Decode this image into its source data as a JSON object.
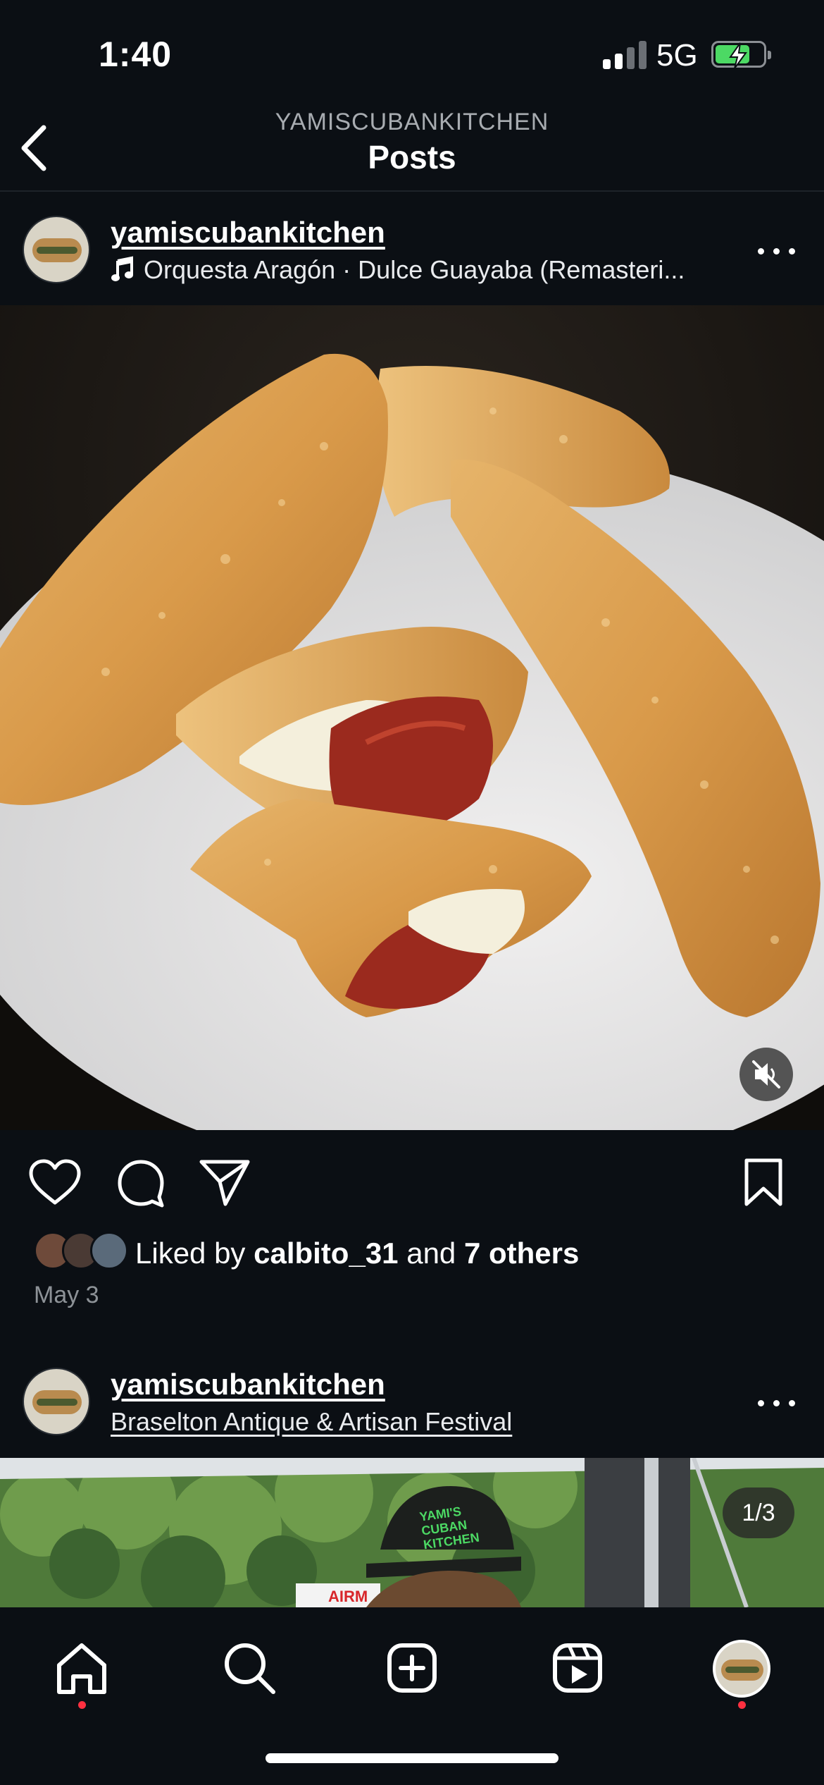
{
  "status_bar": {
    "time": "1:40",
    "network": "5G",
    "battery_color": "#4cd964"
  },
  "header": {
    "subtitle": "YAMISCUBANKITCHEN",
    "title": "Posts"
  },
  "post1": {
    "username": "yamiscubankitchen",
    "audio": "Orquesta Aragón · Dulce Guayaba (Remasteri...",
    "liked_by_prefix": "Liked by ",
    "liked_by_user": "calbito_31",
    "liked_by_mid": " and ",
    "liked_by_others": "7 others",
    "date": "May 3",
    "media_muted": true
  },
  "post2": {
    "username": "yamiscubankitchen",
    "location": "Braselton Antique & Artisan Festival",
    "pager": "1/3",
    "hat_text": "YAMI'S CUBAN KITCHEN",
    "banner_text": "AIRM"
  },
  "tabbar": {
    "items": [
      "home",
      "search",
      "create",
      "reels",
      "profile"
    ],
    "notification_color": "#ff3040"
  },
  "icons": [
    "back-chevron-icon",
    "music-note-icon",
    "more-icon",
    "mute-icon",
    "heart-icon",
    "comment-icon",
    "share-icon",
    "bookmark-icon",
    "home-icon",
    "search-icon",
    "create-icon",
    "reels-icon",
    "profile-avatar"
  ]
}
